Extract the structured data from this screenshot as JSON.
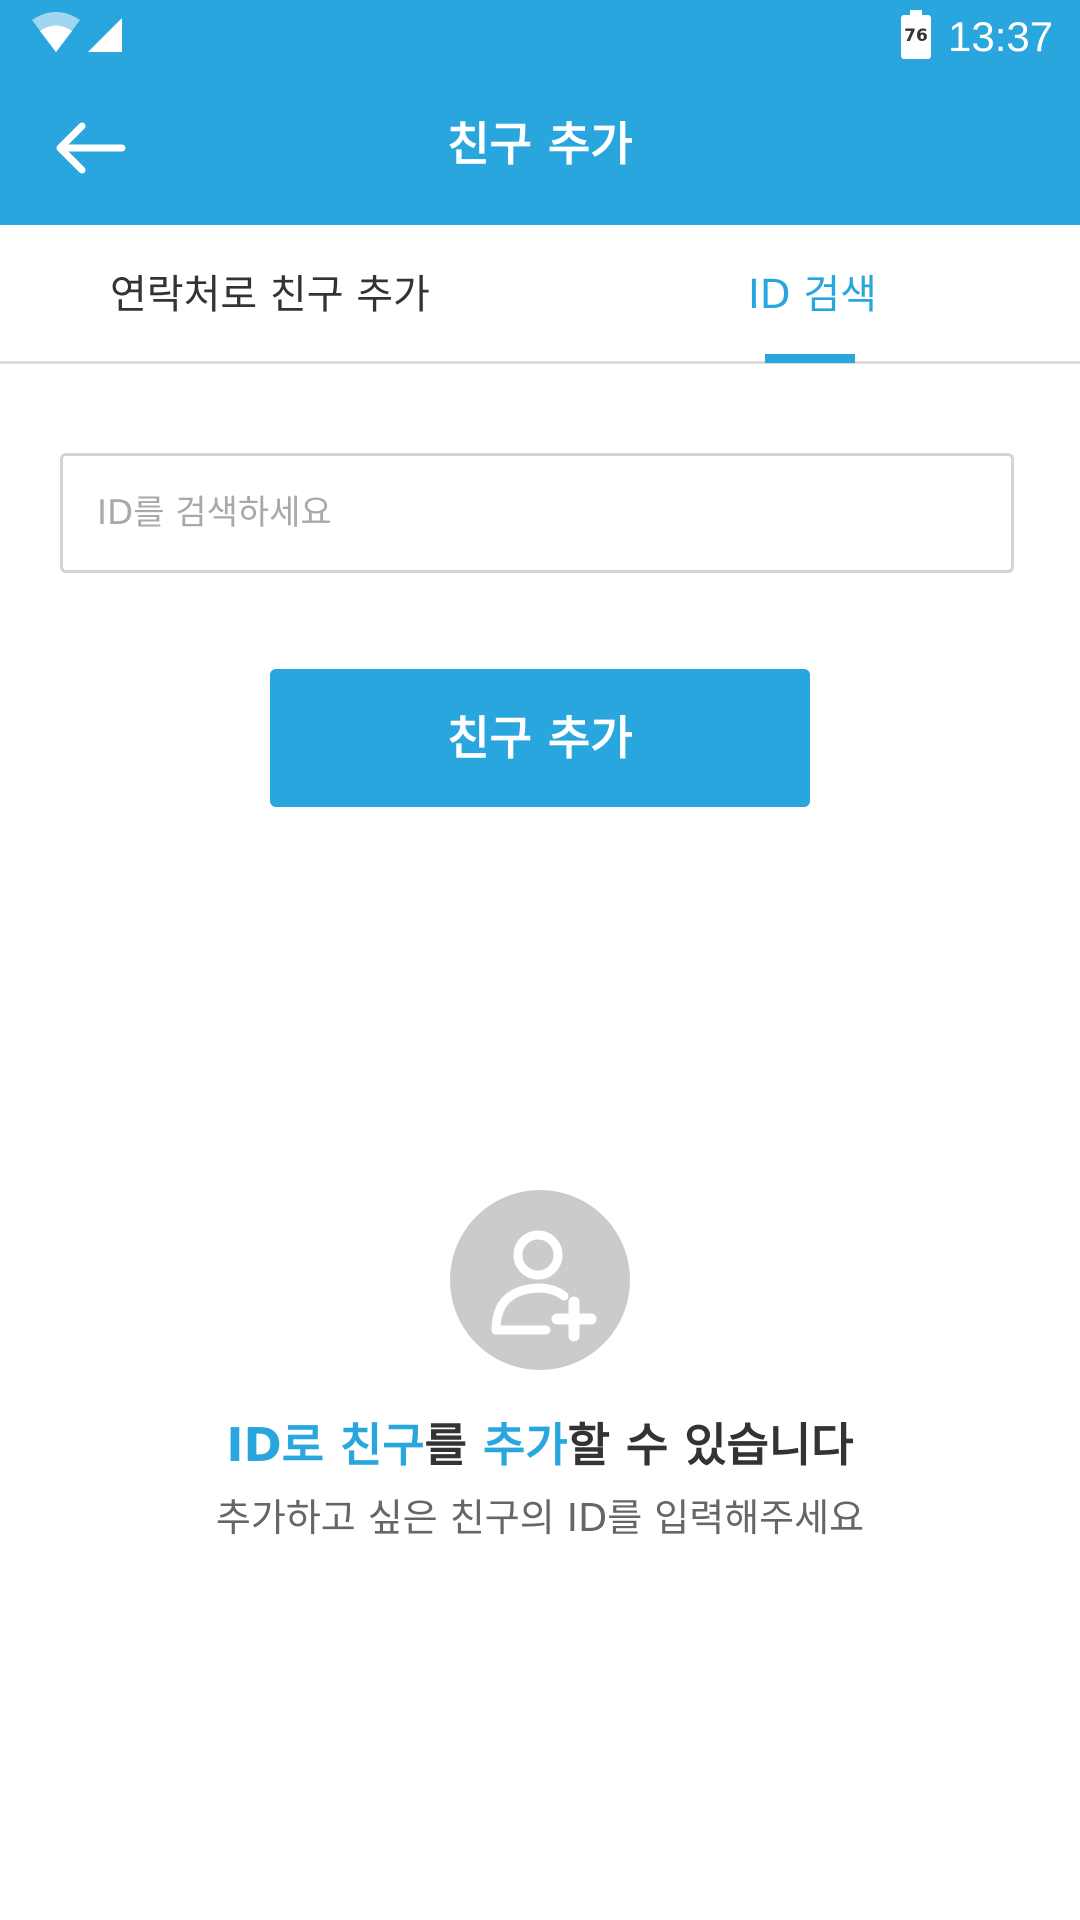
{
  "status_bar": {
    "time": "13:37",
    "battery_level": "76",
    "icons": [
      "wifi-icon",
      "signal-icon",
      "battery-icon"
    ]
  },
  "app_bar": {
    "title": "친구 추가",
    "back_icon": "arrow-left-icon"
  },
  "tabs": [
    {
      "label": "연락처로 친구 추가",
      "selected": false
    },
    {
      "label": "ID 검색",
      "selected": true
    }
  ],
  "search": {
    "placeholder": "ID를 검색하세요",
    "value": ""
  },
  "add_button": {
    "label": "친구 추가"
  },
  "empty_state": {
    "icon": "add-user-icon",
    "headline_parts": [
      "ID로 친구",
      "를 ",
      "추가",
      "할 수 있습니다"
    ],
    "subtext": "추가하고 싶은 친구의 ID를 입력해주세요"
  },
  "colors": {
    "accent": "#2aa6df",
    "text_dark": "#333333",
    "text_muted": "#666666",
    "placeholder": "#a9a9a9",
    "avatar_bg": "#cbcbcb"
  }
}
